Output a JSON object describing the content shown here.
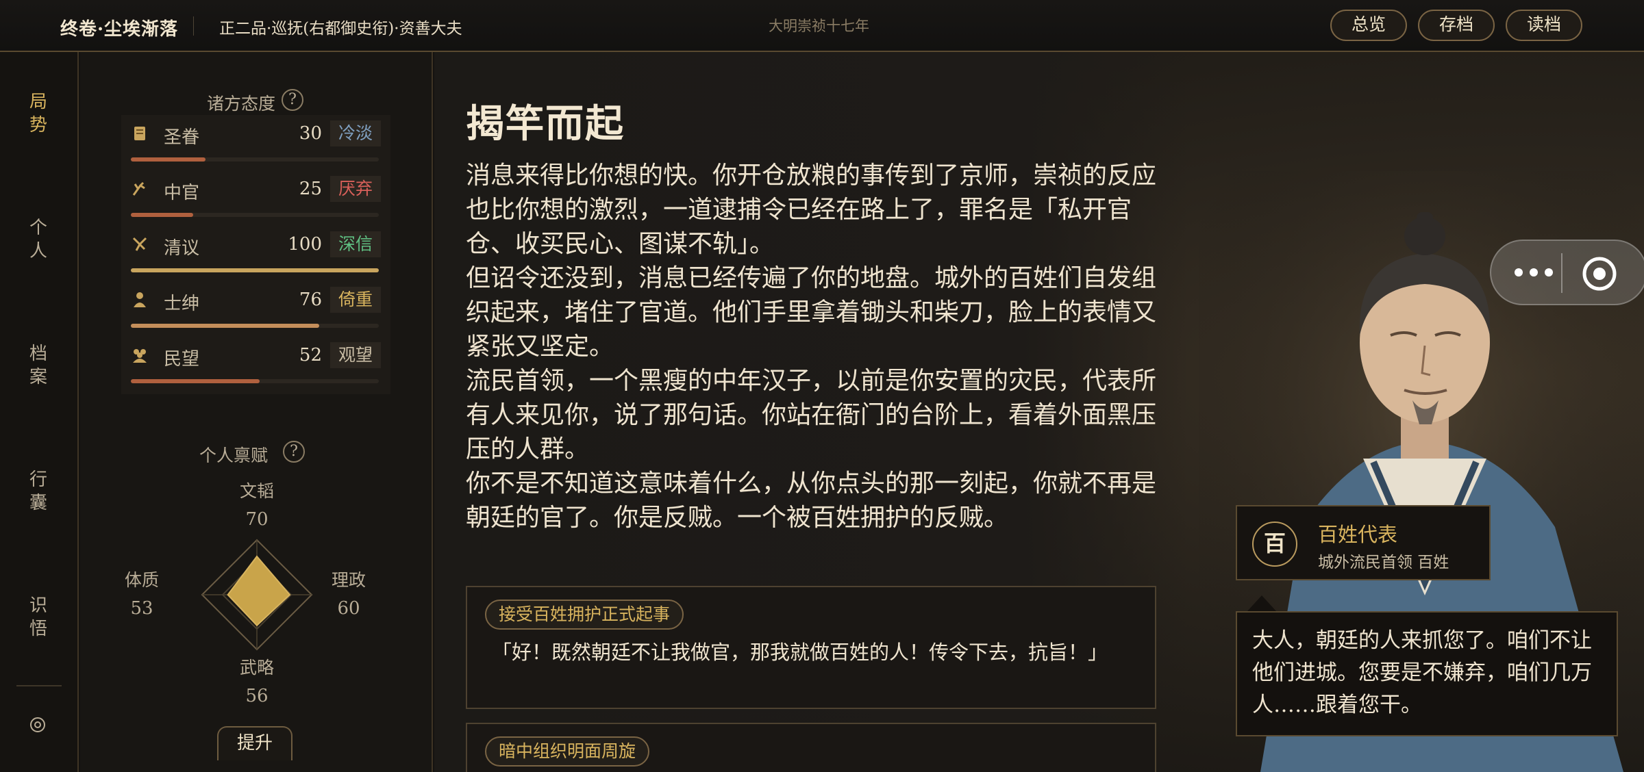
{
  "header": {
    "game_title": "终卷·尘埃渐落",
    "rank": "正二品·巡抚(右都御史衔)·资善大夫",
    "era": "大明崇祯十七年",
    "buttons": {
      "overview": "总览",
      "save": "存档",
      "load": "读档"
    }
  },
  "nav": {
    "items": [
      {
        "label": "局\n势",
        "active": true
      },
      {
        "label": "个\n人"
      },
      {
        "label": "档\n案"
      },
      {
        "label": "行\n囊"
      },
      {
        "label": "识\n悟"
      }
    ]
  },
  "factions": {
    "title": "诸方态度",
    "help": "?",
    "items": [
      {
        "name": "圣眷",
        "value": 30,
        "tag": "冷淡",
        "tag_color": "#7f9fc0",
        "bar_color": "#b0603e",
        "icon": "scroll-icon"
      },
      {
        "name": "中官",
        "value": 25,
        "tag": "厌弃",
        "tag_color": "#d9605a",
        "bar_color": "#b0603e",
        "icon": "whisk-icon"
      },
      {
        "name": "清议",
        "value": 100,
        "tag": "深信",
        "tag_color": "#5fbf82",
        "bar_color": "#c9a55e",
        "icon": "brush-icon"
      },
      {
        "name": "士绅",
        "value": 76,
        "tag": "倚重",
        "tag_color": "#d9b45e",
        "bar_color": "#c48e5a",
        "icon": "gentry-icon"
      },
      {
        "name": "民望",
        "value": 52,
        "tag": "观望",
        "tag_color": "#c9bda5",
        "bar_color": "#b0603e",
        "icon": "people-icon"
      }
    ]
  },
  "talents": {
    "title": "个人禀赋",
    "help": "?",
    "stats": {
      "wentao": {
        "label": "文韬",
        "value": 70
      },
      "lizheng": {
        "label": "理政",
        "value": 60
      },
      "wulue": {
        "label": "武略",
        "value": 56
      },
      "tizhi": {
        "label": "体质",
        "value": 53
      }
    },
    "max": 100,
    "upgrade_label": "提升"
  },
  "story": {
    "title": "揭竿而起",
    "paragraphs": [
      "消息来得比你想的快。你开仓放粮的事传到了京师，崇祯的反应也比你想的激烈，一道逮捕令已经在路上了，罪名是「私开官仓、收买民心、图谋不轨」。",
      "但诏令还没到，消息已经传遍了你的地盘。城外的百姓们自发组织起来，堵住了官道。他们手里拿着锄头和柴刀，脸上的表情又紧张又坚定。",
      "流民首领，一个黑瘦的中年汉子，以前是你安置的灾民，代表所有人来见你，说了那句话。你站在衙门的台阶上，看着外面黑压压的人群。",
      "你不是不知道这意味着什么，从你点头的那一刻起，你就不再是朝廷的官了。你是反贼。一个被百姓拥护的反贼。"
    ],
    "choices": [
      {
        "title": "接受百姓拥护正式起事",
        "text": "「好！既然朝廷不让我做官，那我就做百姓的人！传令下去，抗旨！」"
      },
      {
        "title": "暗中组织明面周旋",
        "text": ""
      }
    ]
  },
  "npc": {
    "avatar_char": "百",
    "name": "百姓代表",
    "subtitle": "城外流民首领  百姓",
    "speech": "大人，朝廷的人来抓您了。咱们不让他们进城。您要是不嫌弃，咱们几万人……跟着您干。"
  },
  "colors": {
    "accent": "#d9b45e",
    "border": "#5a4a30",
    "background": "#141210"
  }
}
